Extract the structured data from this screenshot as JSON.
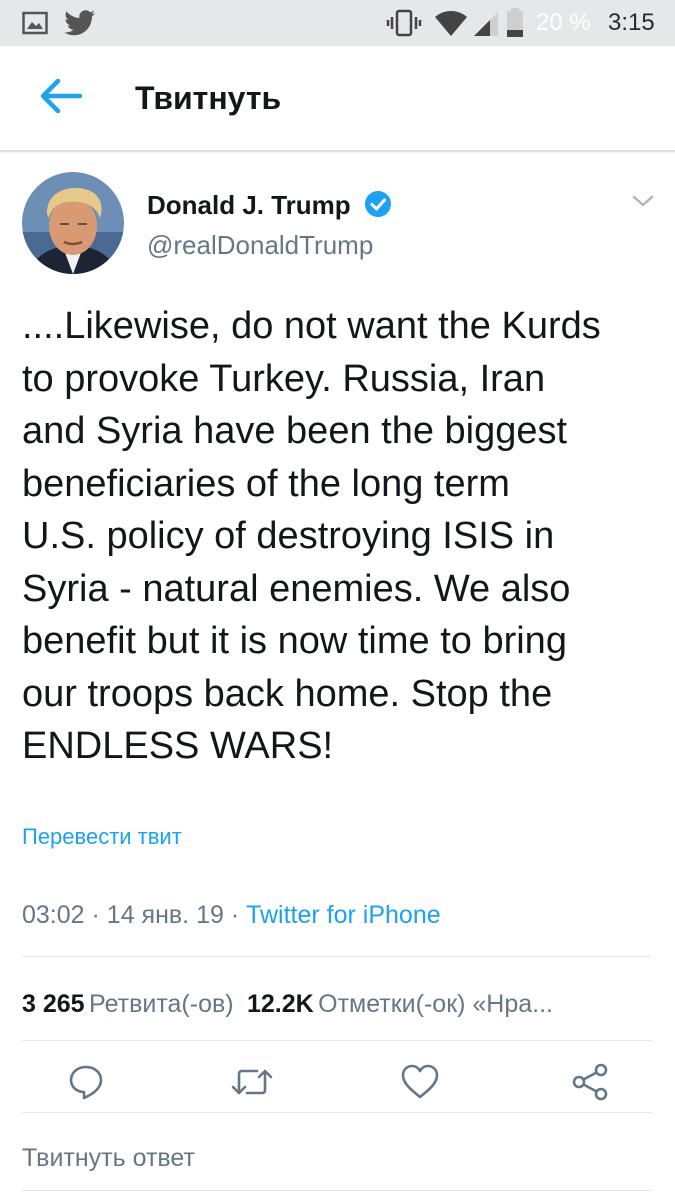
{
  "status_bar": {
    "icons": [
      "gallery-icon",
      "twitter-bird-icon",
      "vibrate-icon",
      "wifi-icon",
      "signal-icon",
      "battery-icon"
    ],
    "battery": "20 %",
    "time": "3:15"
  },
  "app_bar": {
    "back_icon": "arrow-left-icon",
    "title": "Твитнуть"
  },
  "tweet": {
    "author_name": "Donald J. Trump",
    "verified": true,
    "handle": "@realDonaldTrump",
    "text_lines": [
      "....Likewise, do not want the Kurds",
      "to provoke Turkey. Russia, Iran",
      "and Syria have been the biggest",
      "beneficiaries of the long term",
      "U.S. policy of destroying ISIS in",
      "Syria - natural enemies. We also",
      "benefit but it is now time to bring",
      "our troops back home. Stop the",
      "ENDLESS WARS!"
    ],
    "translate": "Перевести твит",
    "time": "03:02",
    "date": "14 янв. 19",
    "separator": "·",
    "source": "Twitter for iPhone"
  },
  "stats": {
    "retweets_count": "3 265",
    "retweets_label": "Ретвита(-ов)",
    "likes_count": "12.2K",
    "likes_label": "Отметки(-ок) «Нра..."
  },
  "actions": [
    "reply-icon",
    "retweet-icon",
    "like-icon",
    "share-icon"
  ],
  "reply": {
    "placeholder": "Твитнуть ответ"
  },
  "colors": {
    "accent": "#1da1f2",
    "text": "#14171a",
    "secondary": "#657786",
    "status_bar_bg": "#e6e7e8"
  }
}
